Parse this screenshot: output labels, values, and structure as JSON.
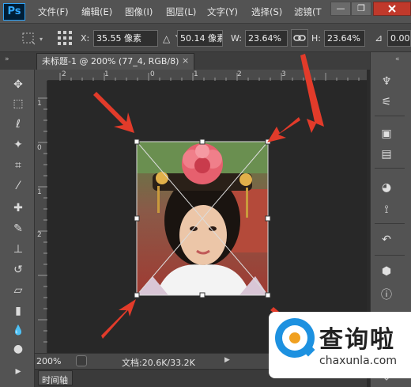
{
  "app": {
    "logo": "Ps"
  },
  "menu": [
    "文件(F)",
    "编辑(E)",
    "图像(I)",
    "图层(L)",
    "文字(Y)",
    "选择(S)",
    "滤镜(T"
  ],
  "window_controls": {
    "minimize": "—",
    "restore": "❐"
  },
  "options": {
    "x_label": "X:",
    "x_value": "35.55 像素",
    "y_label": "Y:",
    "y_value": "50.14 像素",
    "w_label": "W:",
    "w_value": "23.64%",
    "h_label": "H:",
    "h_value": "23.64%",
    "angle_value": "0.00",
    "delta_symbol": "△",
    "angle_symbol": "⊿"
  },
  "document_tab": {
    "title": "未标题-1 @ 200% (77_4, RGB/8)",
    "close": "×"
  },
  "ruler": {
    "horizontal": [
      "2",
      "1",
      "0",
      "1",
      "2",
      "3"
    ],
    "vertical": [
      "1",
      "0",
      "1",
      "2"
    ]
  },
  "status": {
    "zoom": "200%",
    "doc_info": "文档:20.6K/33.2K"
  },
  "timeline_label": "时间轴",
  "tools": [
    {
      "name": "move-tool-icon",
      "glyph": "✥"
    },
    {
      "name": "marquee-tool-icon",
      "glyph": "⬚"
    },
    {
      "name": "lasso-tool-icon",
      "glyph": "ℓ"
    },
    {
      "name": "magic-wand-tool-icon",
      "glyph": "✦"
    },
    {
      "name": "crop-tool-icon",
      "glyph": "⌗"
    },
    {
      "name": "eyedropper-tool-icon",
      "glyph": "⁄"
    },
    {
      "name": "healing-brush-tool-icon",
      "glyph": "✚"
    },
    {
      "name": "brush-tool-icon",
      "glyph": "✎"
    },
    {
      "name": "stamp-tool-icon",
      "glyph": "⊥"
    },
    {
      "name": "history-brush-tool-icon",
      "glyph": "↺"
    },
    {
      "name": "eraser-tool-icon",
      "glyph": "▱"
    },
    {
      "name": "gradient-tool-icon",
      "glyph": "▮"
    },
    {
      "name": "blur-tool-icon",
      "glyph": "💧"
    },
    {
      "name": "dodge-tool-icon",
      "glyph": "●"
    },
    {
      "name": "path-selection-tool-icon",
      "glyph": "▸"
    }
  ],
  "right_panel_icons": [
    "brush-presets-icon",
    "sliders-icon",
    "info-icon",
    "notes-icon",
    "color-wheel-icon",
    "paths-icon",
    "history-icon",
    "3d-icon",
    "info-circle-icon",
    "layers-icon"
  ],
  "watermark": {
    "name": "查询啦",
    "url": "chaxunla.com"
  },
  "colors": {
    "arrow": "#e23b2a",
    "accent": "#31a8ff",
    "watermark_blue": "#1d91e0",
    "watermark_orange": "#f0a020"
  }
}
